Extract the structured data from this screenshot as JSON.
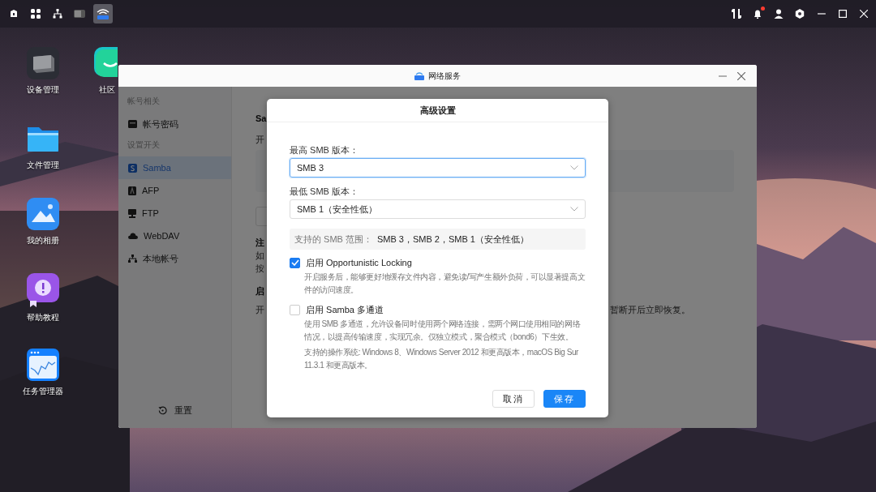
{
  "taskbar": {
    "apps": [
      {
        "kind": "box",
        "selected": false
      },
      {
        "kind": "grid",
        "selected": false
      },
      {
        "kind": "network",
        "selected": false
      },
      {
        "kind": "device",
        "selected": false
      },
      {
        "kind": "wifi",
        "selected": true
      }
    ],
    "tray": [
      {
        "kind": "transfer",
        "badge": false
      },
      {
        "kind": "bell",
        "badge": true
      },
      {
        "kind": "user",
        "badge": false
      },
      {
        "kind": "settings",
        "badge": false
      }
    ]
  },
  "desktop_icons": [
    {
      "label": "设备管理",
      "kind": "device"
    },
    {
      "label": "文件管理",
      "kind": "files"
    },
    {
      "label": "我的相册",
      "kind": "photos"
    },
    {
      "label": "帮助教程",
      "kind": "help"
    },
    {
      "label": "任务管理器",
      "kind": "tasks"
    },
    {
      "label": "社区",
      "kind": "community"
    }
  ],
  "window": {
    "title": "网络服务",
    "sidebar": {
      "groups": [
        {
          "heading": "帐号相关",
          "items": [
            {
              "label": "帐号密码",
              "kind": "card",
              "selected": false
            }
          ]
        },
        {
          "heading": "设置开关",
          "items": [
            {
              "label": "Samba",
              "kind": "samba",
              "selected": true
            },
            {
              "label": "AFP",
              "kind": "afp",
              "selected": false
            },
            {
              "label": "FTP",
              "kind": "ftp",
              "selected": false
            },
            {
              "label": "WebDAV",
              "kind": "cloud",
              "selected": false
            },
            {
              "label": "本地帐号",
              "kind": "tree",
              "selected": false
            }
          ]
        }
      ],
      "reset_button": "重置"
    },
    "covered_content": {
      "heading": "Sa",
      "line_1": "开",
      "note_heading": "注",
      "note_lines": [
        "如",
        "按"
      ],
      "section_heading": "启",
      "section_line": "开",
      "section_line_end": "暂断开后立即恢复。"
    }
  },
  "dialog": {
    "title": "高级设置",
    "fields": [
      {
        "label": "最高 SMB 版本：",
        "value": "SMB 3",
        "focused": true
      },
      {
        "label": "最低 SMB 版本：",
        "value": "SMB 1（安全性低）",
        "focused": false
      }
    ],
    "range": {
      "label": "支持的 SMB 范围：",
      "value": "SMB 3，SMB 2，SMB 1（安全性低）"
    },
    "options": [
      {
        "label": "启用 Opportunistic Locking",
        "checked": true,
        "descriptions": [
          "开启服务后，能够更好地缓存文件内容，避免读/写产生额外负荷，可以显著提高文件的访问速度。"
        ]
      },
      {
        "label": "启用 Samba 多通道",
        "checked": false,
        "descriptions": [
          "使用 SMB 多通道，允许设备同时使用两个网络连接，需两个网口使用相同的网络情况，以提高传输速度，实现冗余。仅独立模式，聚合模式（bond6）下生效。",
          "支持的操作系统: Windows 8、Windows Server 2012 和更高版本，macOS Big Sur 11.3.1 和更高版本。"
        ]
      }
    ],
    "buttons": [
      {
        "label": "取消",
        "kind": "secondary"
      },
      {
        "label": "保存",
        "kind": "primary"
      }
    ]
  }
}
